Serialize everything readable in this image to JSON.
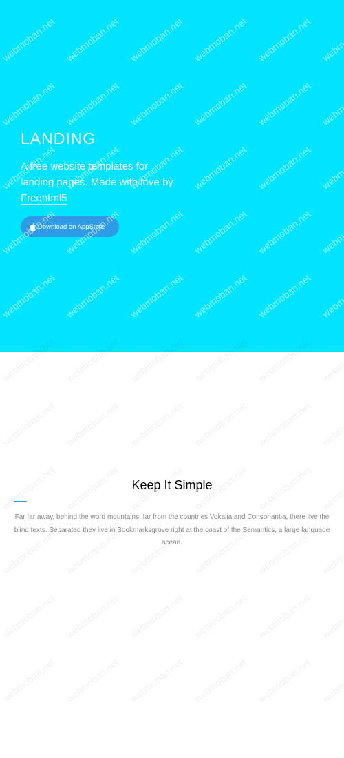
{
  "hero": {
    "title": "LANDING",
    "tagline_prefix": "A free website templates for landing pages. Made with love by ",
    "tagline_link": "Freehtml5",
    "button_label": "Download on AppStore",
    "background_color": "#00e4ff",
    "button_color": "#2d9be6"
  },
  "feature": {
    "title": "Keep It Simple",
    "body": "Far far away, behind the word mountains, far from the countries Vokalia and Consonantia, there live the blind texts. Separated they live in Bookmarksgrove right at the coast of the Semantics, a large language ocean.",
    "accent_color": "#2d9be6"
  },
  "watermark": {
    "text": "webmoban.net"
  },
  "icons": {
    "button_icon": "apple-icon"
  }
}
